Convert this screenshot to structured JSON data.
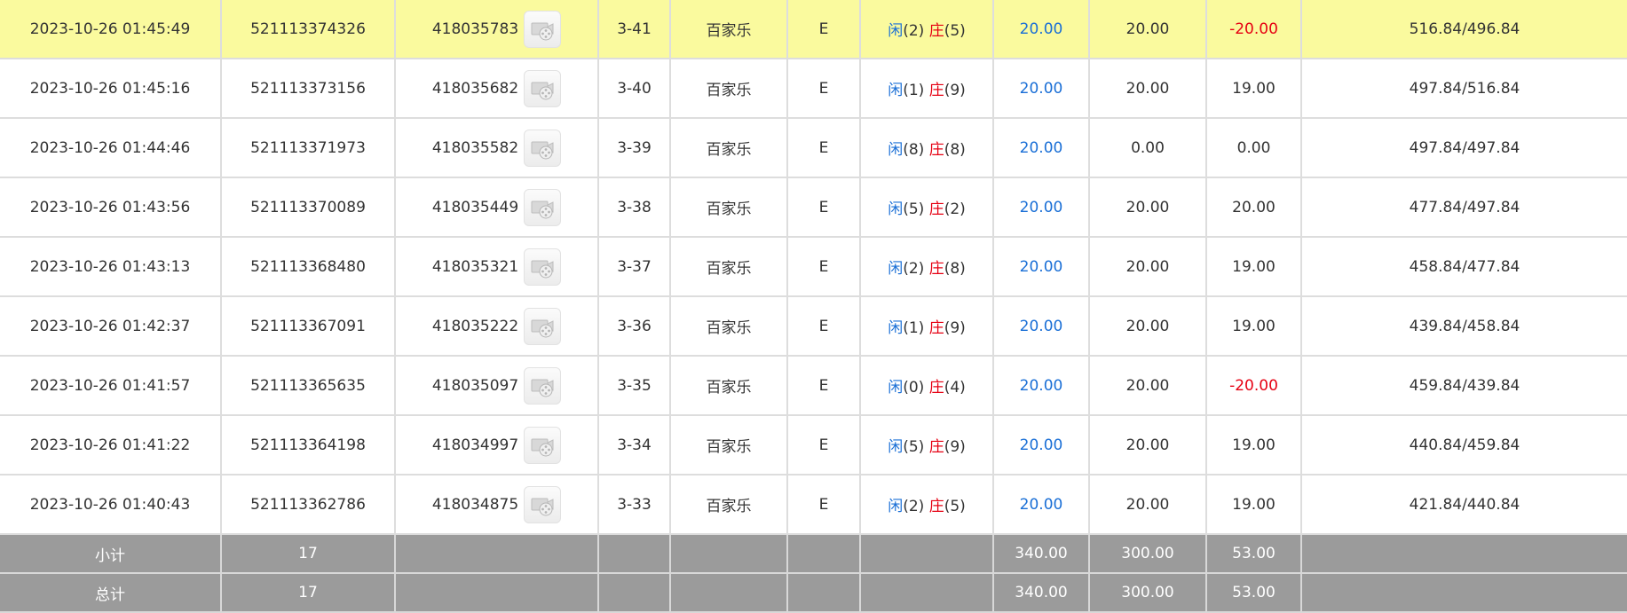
{
  "records": [
    {
      "time": "2023-10-26 01:45:49",
      "order_no": "521113374326",
      "bet_no": "418035783",
      "round": "3-41",
      "game": "百家乐",
      "table": "E",
      "player_label": "闲",
      "player_points": "(2)",
      "banker_label": "庄",
      "banker_points": "(5)",
      "bet_amount": "20.00",
      "valid_bet": "20.00",
      "win_loss": "-20.00",
      "balance": "516.84/496.84"
    },
    {
      "time": "2023-10-26 01:45:16",
      "order_no": "521113373156",
      "bet_no": "418035682",
      "round": "3-40",
      "game": "百家乐",
      "table": "E",
      "player_label": "闲",
      "player_points": "(1)",
      "banker_label": "庄",
      "banker_points": "(9)",
      "bet_amount": "20.00",
      "valid_bet": "20.00",
      "win_loss": "19.00",
      "balance": "497.84/516.84"
    },
    {
      "time": "2023-10-26 01:44:46",
      "order_no": "521113371973",
      "bet_no": "418035582",
      "round": "3-39",
      "game": "百家乐",
      "table": "E",
      "player_label": "闲",
      "player_points": "(8)",
      "banker_label": "庄",
      "banker_points": "(8)",
      "bet_amount": "20.00",
      "valid_bet": "0.00",
      "win_loss": "0.00",
      "balance": "497.84/497.84"
    },
    {
      "time": "2023-10-26 01:43:56",
      "order_no": "521113370089",
      "bet_no": "418035449",
      "round": "3-38",
      "game": "百家乐",
      "table": "E",
      "player_label": "闲",
      "player_points": "(5)",
      "banker_label": "庄",
      "banker_points": "(2)",
      "bet_amount": "20.00",
      "valid_bet": "20.00",
      "win_loss": "20.00",
      "balance": "477.84/497.84"
    },
    {
      "time": "2023-10-26 01:43:13",
      "order_no": "521113368480",
      "bet_no": "418035321",
      "round": "3-37",
      "game": "百家乐",
      "table": "E",
      "player_label": "闲",
      "player_points": "(2)",
      "banker_label": "庄",
      "banker_points": "(8)",
      "bet_amount": "20.00",
      "valid_bet": "20.00",
      "win_loss": "19.00",
      "balance": "458.84/477.84"
    },
    {
      "time": "2023-10-26 01:42:37",
      "order_no": "521113367091",
      "bet_no": "418035222",
      "round": "3-36",
      "game": "百家乐",
      "table": "E",
      "player_label": "闲",
      "player_points": "(1)",
      "banker_label": "庄",
      "banker_points": "(9)",
      "bet_amount": "20.00",
      "valid_bet": "20.00",
      "win_loss": "19.00",
      "balance": "439.84/458.84"
    },
    {
      "time": "2023-10-26 01:41:57",
      "order_no": "521113365635",
      "bet_no": "418035097",
      "round": "3-35",
      "game": "百家乐",
      "table": "E",
      "player_label": "闲",
      "player_points": "(0)",
      "banker_label": "庄",
      "banker_points": "(4)",
      "bet_amount": "20.00",
      "valid_bet": "20.00",
      "win_loss": "-20.00",
      "balance": "459.84/439.84"
    },
    {
      "time": "2023-10-26 01:41:22",
      "order_no": "521113364198",
      "bet_no": "418034997",
      "round": "3-34",
      "game": "百家乐",
      "table": "E",
      "player_label": "闲",
      "player_points": "(5)",
      "banker_label": "庄",
      "banker_points": "(9)",
      "bet_amount": "20.00",
      "valid_bet": "20.00",
      "win_loss": "19.00",
      "balance": "440.84/459.84"
    },
    {
      "time": "2023-10-26 01:40:43",
      "order_no": "521113362786",
      "bet_no": "418034875",
      "round": "3-33",
      "game": "百家乐",
      "table": "E",
      "player_label": "闲",
      "player_points": "(2)",
      "banker_label": "庄",
      "banker_points": "(5)",
      "bet_amount": "20.00",
      "valid_bet": "20.00",
      "win_loss": "19.00",
      "balance": "421.84/440.84"
    }
  ],
  "subtotal": {
    "label": "小计",
    "count": "17",
    "bet_amount": "340.00",
    "valid_bet": "300.00",
    "win_loss": "53.00"
  },
  "total": {
    "label": "总计",
    "count": "17",
    "bet_amount": "340.00",
    "valid_bet": "300.00",
    "win_loss": "53.00"
  },
  "icons": {
    "replay": "video-replay-icon"
  },
  "colors": {
    "highlight_row": "#fafa9e",
    "player": "#1a6fd6",
    "banker": "#e60012",
    "loss": "#e60012",
    "summary_bg": "#9b9b9b"
  }
}
